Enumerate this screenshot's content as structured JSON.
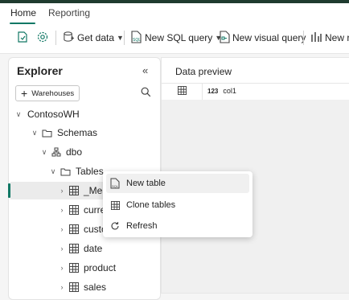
{
  "tabs": [
    {
      "label": "Home",
      "active": true
    },
    {
      "label": "Reporting",
      "active": false
    }
  ],
  "toolbar": {
    "get_data": "Get data",
    "new_sql_query": "New SQL query",
    "new_visual_query": "New visual query",
    "new_report": "New re"
  },
  "explorer": {
    "title": "Explorer",
    "warehouses_button": "Warehouses",
    "tree": [
      {
        "label": "ContosoWH",
        "caret": "collapse",
        "icon": "none"
      },
      {
        "label": "Schemas",
        "caret": "collapse",
        "icon": "folder-icon"
      },
      {
        "label": "dbo",
        "caret": "collapse",
        "icon": "schema-icon"
      },
      {
        "label": "Tables",
        "caret": "collapse",
        "icon": "folder-icon"
      },
      {
        "label": "_Meas",
        "caret": "expand",
        "icon": "table-icon",
        "selected": true
      },
      {
        "label": "currer",
        "caret": "expand",
        "icon": "table-icon"
      },
      {
        "label": "custo",
        "caret": "expand",
        "icon": "table-icon"
      },
      {
        "label": "date",
        "caret": "expand",
        "icon": "table-icon"
      },
      {
        "label": "product",
        "caret": "expand",
        "icon": "table-icon"
      },
      {
        "label": "sales",
        "caret": "expand",
        "icon": "table-icon"
      }
    ]
  },
  "preview": {
    "title": "Data preview",
    "column": {
      "type": "123",
      "name": "col1"
    }
  },
  "context_menu": [
    {
      "label": "New table",
      "icon": "new-table-icon"
    },
    {
      "label": "Clone tables",
      "icon": "table-icon"
    },
    {
      "label": "Refresh",
      "icon": "refresh-icon"
    }
  ],
  "colors": {
    "accent": "#117865",
    "dark_strip": "#1f3b2f"
  }
}
